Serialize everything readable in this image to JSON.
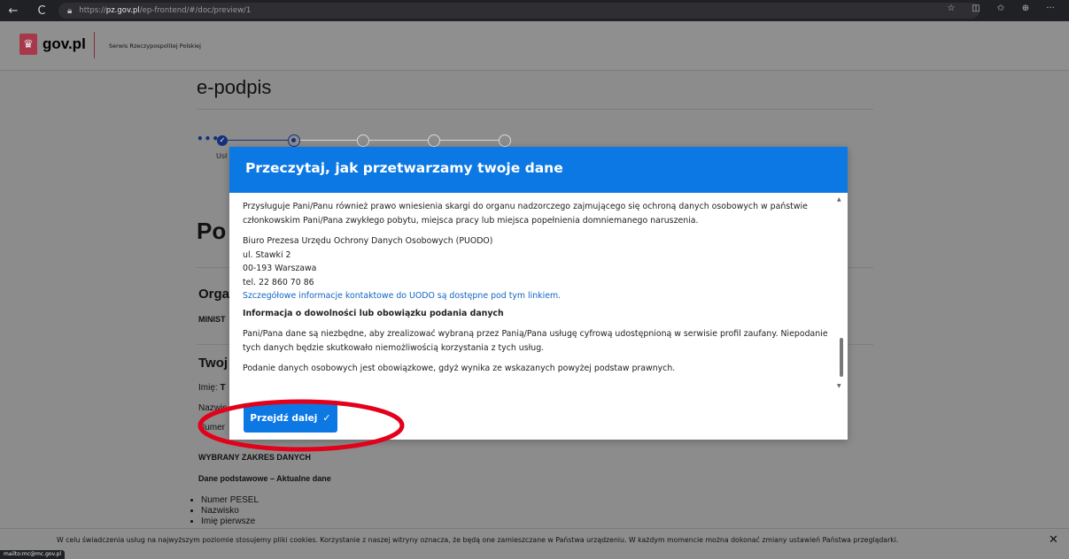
{
  "browser": {
    "back": "←",
    "reload": "C",
    "url_prefix": "https://",
    "url_domain": "pz.gov.pl",
    "url_path": "/ep-frontend/#/doc/preview/1",
    "icons": [
      "star-icon",
      "split-screen-icon",
      "favorites-icon",
      "collections-icon",
      "more-icon"
    ],
    "icon_glyphs": [
      "☆",
      "◫",
      "✩",
      "⊕",
      "···"
    ]
  },
  "header": {
    "logo_text": "gov.pl",
    "service_name": "Serwis Rzeczypospolitej Polskiej",
    "brand_color": "#d4213d"
  },
  "page": {
    "title": "e-podpis",
    "stepper_dots": "•••",
    "step_label": "Usł",
    "heading": "Po",
    "section1": "Orga",
    "ministry": "MINIST",
    "section2": "Twoj",
    "name_label": "Imię:",
    "name_value": "T",
    "surname_label": "Nazwis",
    "number_label": "Numer",
    "scope_heading": "WYBRANY ZAKRES DANYCH",
    "basic_data": "Dane podstawowe – Aktualne dane",
    "list": [
      "Numer PESEL",
      "Nazwisko",
      "Imię pierwsze"
    ]
  },
  "modal": {
    "title": "Przeczytaj, jak przetwarzamy twoje dane",
    "p1": "Przysługuje Pani/Panu również prawo wniesienia skargi do organu nadzorczego zajmującego się ochroną danych osobowych w państwie członkowskim Pani/Pana zwykłego pobytu, miejsca pracy lub miejsca popełnienia domniemanego naruszenia.",
    "addr1": "Biuro Prezesa Urzędu Ochrony Danych Osobowych (PUODO)",
    "addr2": "ul. Stawki 2",
    "addr3": "00-193 Warszawa",
    "addr4": "tel. 22 860 70 86",
    "link": "Szczegółowe informacje kontaktowe do UODO są dostępne pod tym linkiem.",
    "h_info": "Informacja o dowolności lub obowiązku podania danych",
    "p2": "Pani/Pana dane są niezbędne, aby zrealizować wybraną przez Panią/Pana usługę cyfrową udostępnioną w serwisie profil zaufany. Niepodanie tych danych będzie skutkowało niemożliwością korzystania z tych usług.",
    "p3": "Podanie danych osobowych jest obowiązkowe, gdyż wynika ze wskazanych powyżej podstaw prawnych.",
    "button": "Przejdź dalej",
    "button_icon": "✓",
    "scroll_up": "▲",
    "scroll_down": "▼",
    "header_color": "#0c78e4"
  },
  "annotation": {
    "ellipse_color": "#e3001b"
  },
  "cookies": {
    "text": "W celu świadczenia usług na najwyższym poziomie stosujemy pliki cookies. Korzystanie z naszej witryny oznacza, że będą one zamieszczane w Państwa urządzeniu. W każdym momencie można dokonać zmiany ustawień Państwa przeglądarki.",
    "close": "✕"
  },
  "status_bar": "mailto:mc@mc.gov.pl"
}
